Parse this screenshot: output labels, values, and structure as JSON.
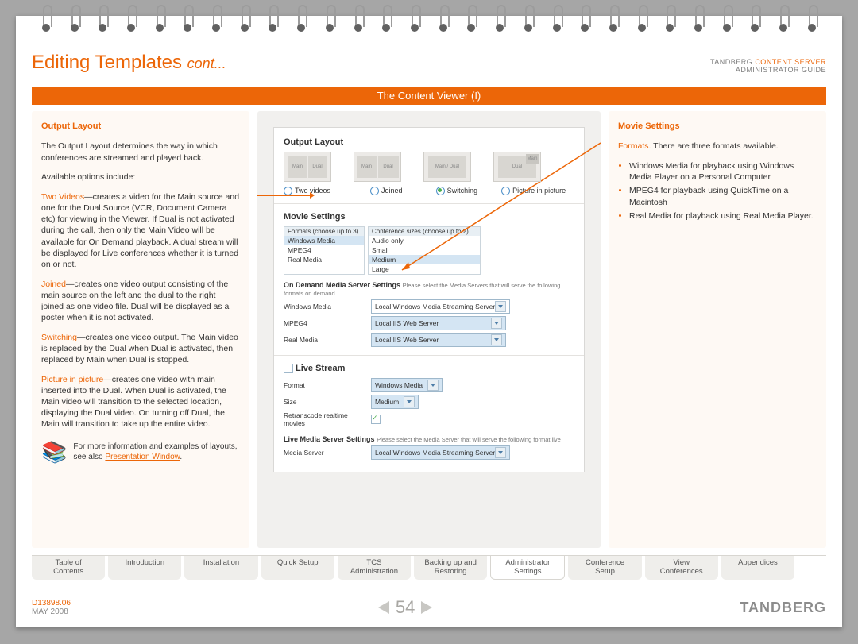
{
  "header": {
    "title": "Editing Templates",
    "cont": "cont...",
    "brand_line1_a": "TANDBERG ",
    "brand_line1_b": "CONTENT SERVER",
    "brand_line2": "ADMINISTRATOR GUIDE"
  },
  "bar": {
    "title": "The Content Viewer (I)"
  },
  "left": {
    "h": "Output Layout",
    "p1": "The Output Layout determines the way in which conferences are streamed and played back.",
    "p2": "Available options include:",
    "two_t": "Two Videos",
    "two_d": "—creates a video for the Main source and one for the Dual Source (VCR, Document Camera etc) for viewing in the Viewer. If Dual is not activated during the call, then only the Main Video will be available for On Demand playback. A dual stream will be displayed for Live conferences whether it is turned on or not.",
    "join_t": "Joined",
    "join_d": "—creates one video output consisting of the main source on the left and the dual to the right joined as one video file. Dual will be displayed as a poster when it is not activated.",
    "sw_t": "Switching",
    "sw_d": "—creates one video output. The Main video is replaced by the Dual when Dual is activated, then replaced by Main when Dual is stopped.",
    "pip_t": "Picture in picture",
    "pip_d": "—creates one video with main inserted into the Dual. When Dual is activated, the Main video will transition to the selected location, displaying the Dual video. On turning off Dual, the Main will transition to take up the entire video.",
    "info_a": "For more information and examples of layouts, see also ",
    "info_link": "Presentation Window",
    "info_b": "."
  },
  "center": {
    "ol_h": "Output Layout",
    "opts": {
      "two": "Two videos",
      "join": "Joined",
      "sw": "Switching",
      "pip": "Picture in picture"
    },
    "thumbs": {
      "main": "Main",
      "dual": "Dual",
      "md": "Main / Dual"
    },
    "ms_h": "Movie Settings",
    "fmt_hdr": "Formats (choose up to 3)",
    "sz_hdr": "Conference sizes (choose up to 2)",
    "fmts": [
      "Windows Media",
      "MPEG4",
      "Real Media"
    ],
    "sizes": [
      "Audio only",
      "Small",
      "Medium",
      "Large"
    ],
    "od_title": "On Demand Media Server Settings",
    "od_note": "Please select the Media Servers that will serve the following formats on demand",
    "srv": {
      "wm_l": "Windows Media",
      "wm_v": "Local Windows Media Streaming Server",
      "mp_l": "MPEG4",
      "mp_v": "Local IIS Web Server",
      "rm_l": "Real Media",
      "rm_v": "Local IIS Web Server"
    },
    "ls_h": "Live Stream",
    "ls": {
      "fmt_l": "Format",
      "fmt_v": "Windows Media",
      "sz_l": "Size",
      "sz_v": "Medium",
      "rt_l": "Retranscode realtime movies"
    },
    "lv_title": "Live Media Server Settings",
    "lv_note": "Please select the Media Server that will serve the following format live",
    "lv_l": "Media Server",
    "lv_v": "Local Windows Media Streaming Server"
  },
  "right": {
    "h": "Movie Settings",
    "fmt_t": "Formats.",
    "fmt_d": " There are three formats available.",
    "items": [
      "Windows Media for playback using Windows Media Player on a Personal Computer",
      "MPEG4 for playback using QuickTime on a Macintosh",
      "Real Media for playback using Real Media Player."
    ]
  },
  "tabs": [
    {
      "l1": "Table of",
      "l2": "Contents"
    },
    {
      "l1": "Introduction",
      "l2": ""
    },
    {
      "l1": "Installation",
      "l2": ""
    },
    {
      "l1": "Quick Setup",
      "l2": ""
    },
    {
      "l1": "TCS",
      "l2": "Administration"
    },
    {
      "l1": "Backing up and",
      "l2": "Restoring"
    },
    {
      "l1": "Administrator",
      "l2": "Settings"
    },
    {
      "l1": "Conference",
      "l2": "Setup"
    },
    {
      "l1": "View",
      "l2": "Conferences"
    },
    {
      "l1": "Appendices",
      "l2": ""
    }
  ],
  "footer": {
    "doc": "D13898.06",
    "date": "MAY 2008",
    "page": "54",
    "logo": "TANDBERG"
  }
}
